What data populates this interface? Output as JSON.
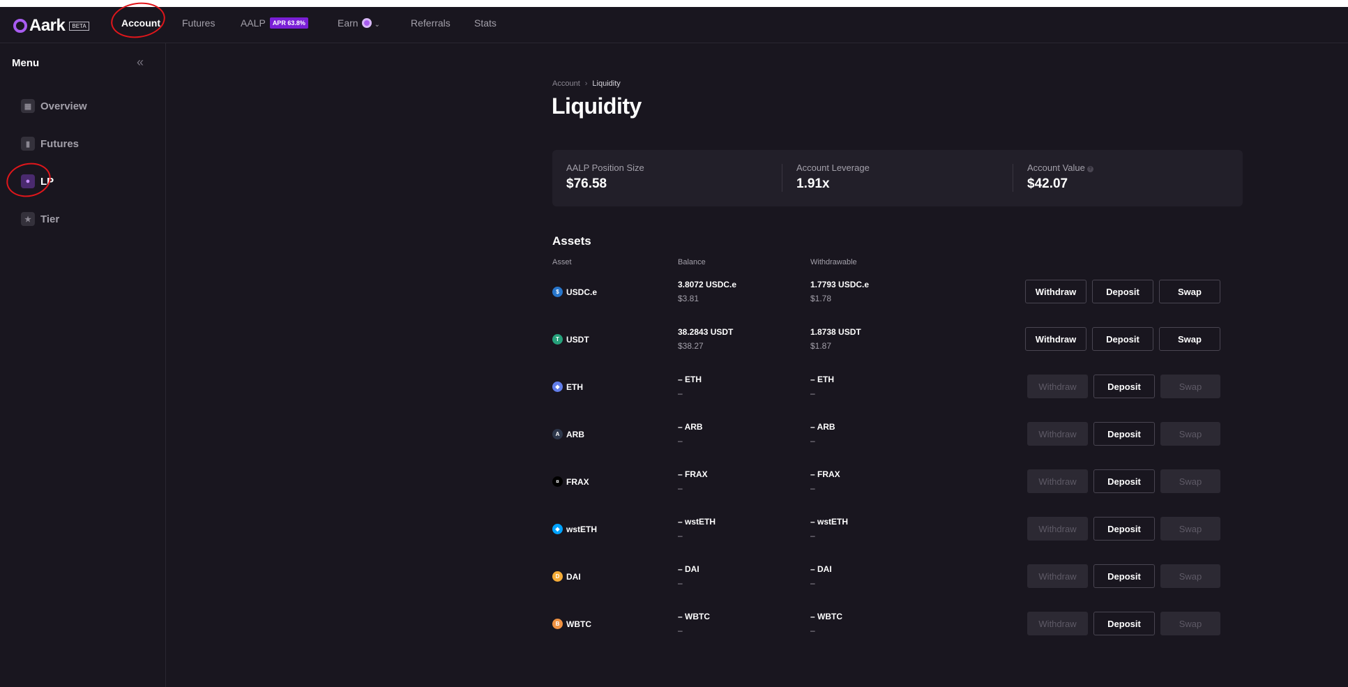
{
  "app": {
    "name": "Aark",
    "badge": "BETA"
  },
  "nav": {
    "account": "Account",
    "futures": "Futures",
    "aalp": "AALP",
    "apr_badge": "APR 63.8%",
    "earn": "Earn",
    "referrals": "Referrals",
    "stats": "Stats"
  },
  "sidebar": {
    "title": "Menu",
    "items": [
      {
        "label": "Overview",
        "icon": "grid-icon"
      },
      {
        "label": "Futures",
        "icon": "bar-chart-icon"
      },
      {
        "label": "LP",
        "icon": "drop-icon",
        "active": true
      },
      {
        "label": "Tier",
        "icon": "star-icon"
      }
    ]
  },
  "breadcrumb": {
    "parent": "Account",
    "current": "Liquidity"
  },
  "page_title": "Liquidity",
  "stats": {
    "position_label": "AALP Position Size",
    "position_value": "$76.58",
    "leverage_label": "Account Leverage",
    "leverage_value": "1.91x",
    "value_label": "Account Value",
    "value_value": "$42.07"
  },
  "assets": {
    "title": "Assets",
    "headers": {
      "asset": "Asset",
      "balance": "Balance",
      "withdrawable": "Withdrawable"
    },
    "buttons": {
      "withdraw": "Withdraw",
      "deposit": "Deposit",
      "swap": "Swap"
    },
    "rows": [
      {
        "symbol": "USDC.e",
        "balance": "3.8072 USDC.e",
        "balance_usd": "$3.81",
        "withdrawable": "1.7793 USDC.e",
        "withdrawable_usd": "$1.78",
        "color": "#2775ca",
        "glyph": "$"
      },
      {
        "symbol": "USDT",
        "balance": "38.2843 USDT",
        "balance_usd": "$38.27",
        "withdrawable": "1.8738 USDT",
        "withdrawable_usd": "$1.87",
        "color": "#26a17b",
        "glyph": "T"
      },
      {
        "symbol": "ETH",
        "balance": "– ETH",
        "balance_usd": "–",
        "withdrawable": "– ETH",
        "withdrawable_usd": "–",
        "color": "#627eea",
        "glyph": "◆"
      },
      {
        "symbol": "ARB",
        "balance": "– ARB",
        "balance_usd": "–",
        "withdrawable": "– ARB",
        "withdrawable_usd": "–",
        "color": "#2d374b",
        "glyph": "A"
      },
      {
        "symbol": "FRAX",
        "balance": "– FRAX",
        "balance_usd": "–",
        "withdrawable": "– FRAX",
        "withdrawable_usd": "–",
        "color": "#000000",
        "glyph": "¤"
      },
      {
        "symbol": "wstETH",
        "balance": "– wstETH",
        "balance_usd": "–",
        "withdrawable": "– wstETH",
        "withdrawable_usd": "–",
        "color": "#00a3ff",
        "glyph": "◆"
      },
      {
        "symbol": "DAI",
        "balance": "– DAI",
        "balance_usd": "–",
        "withdrawable": "– DAI",
        "withdrawable_usd": "–",
        "color": "#f5ac37",
        "glyph": "D"
      },
      {
        "symbol": "WBTC",
        "balance": "– WBTC",
        "balance_usd": "–",
        "withdrawable": "– WBTC",
        "withdrawable_usd": "–",
        "color": "#f09242",
        "glyph": "B"
      }
    ]
  },
  "colors": {
    "bg": "#19161f",
    "accent": "#a85cf0",
    "apr": "#7a1fd6",
    "annotation": "#e0161b"
  }
}
